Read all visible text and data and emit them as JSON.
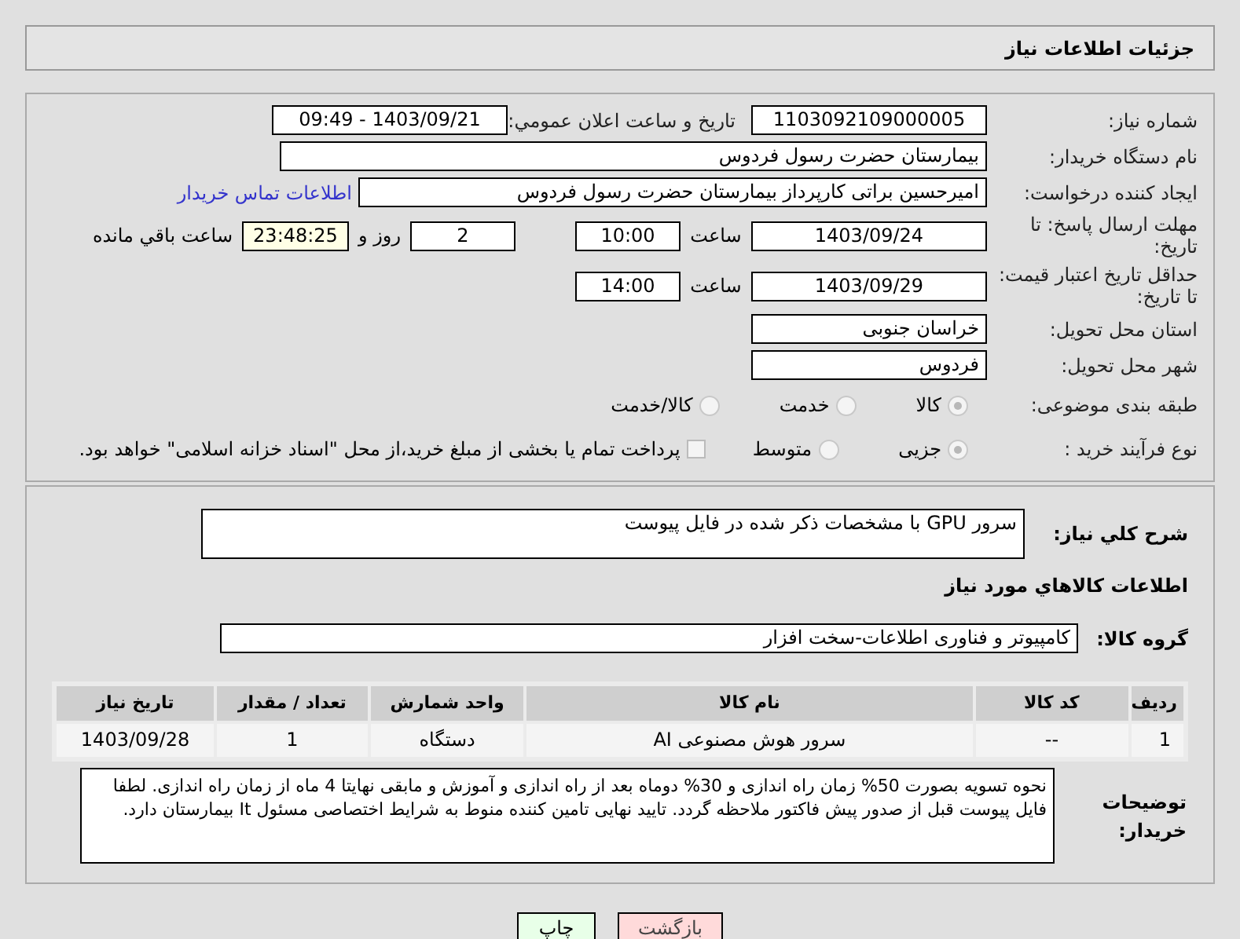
{
  "header": {
    "title": "جزئیات اطلاعات نیاز"
  },
  "details": {
    "need_number": {
      "label": "شماره نیاز:",
      "value": "1103092109000005"
    },
    "announce": {
      "label": "تاریخ و ساعت اعلان عمومي:",
      "value": "1403/09/21 - 09:49"
    },
    "buyer": {
      "label": "نام دستگاه خریدار:",
      "value": "بیمارستان حضرت رسول فردوس"
    },
    "creator": {
      "label": "ایجاد کننده درخواست:",
      "value": "امیرحسین براتی کارپرداز بیمارستان حضرت رسول فردوس",
      "link": "اطلاعات تماس خریدار"
    },
    "deadline": {
      "label": "مهلت ارسال پاسخ: تا تاریخ:",
      "date": "1403/09/24",
      "time_label": "ساعت",
      "time": "10:00",
      "days": "2",
      "days_label": "روز و",
      "remaining": "23:48:25",
      "remaining_label": "ساعت باقي مانده"
    },
    "validity": {
      "label": "حداقل تاریخ اعتبار قیمت: تا تاریخ:",
      "date": "1403/09/29",
      "time_label": "ساعت",
      "time": "14:00"
    },
    "province": {
      "label": "استان محل تحویل:",
      "value": "خراسان جنوبی"
    },
    "city": {
      "label": "شهر محل تحویل:",
      "value": "فردوس"
    },
    "category": {
      "label": "طبقه بندی موضوعی:",
      "options": [
        {
          "label": "کالا",
          "selected": true
        },
        {
          "label": "خدمت",
          "selected": false
        },
        {
          "label": "کالا/خدمت",
          "selected": false
        }
      ]
    },
    "process": {
      "label": "نوع فرآیند خرید :",
      "options": [
        {
          "label": "جزیی",
          "selected": true
        },
        {
          "label": "متوسط",
          "selected": false
        }
      ],
      "treasury": {
        "label": "پرداخت تمام یا بخشی از مبلغ خرید،از محل \"اسناد خزانه اسلامی\" خواهد بود.",
        "checked": false
      }
    }
  },
  "goods": {
    "summary": {
      "label": "شرح کلي نیاز:",
      "value": "سرور GPU  با مشخصات ذکر شده در فایل پیوست"
    },
    "heading": "اطلاعات کالاهاي مورد نیاز",
    "group": {
      "label": "گروه کالا:",
      "value": "کامپیوتر و فناوری اطلاعات-سخت افزار"
    },
    "table": {
      "columns": [
        "ردیف",
        "کد کالا",
        "نام کالا",
        "واحد شمارش",
        "تعداد / مقدار",
        "تاریخ نیاز"
      ],
      "rows": [
        [
          "1",
          "--",
          "سرور هوش مصنوعی AI",
          "دستگاه",
          "1",
          "1403/09/28"
        ]
      ]
    },
    "notes": {
      "label": "توضیحات خریدار:",
      "value": "نحوه تسویه بصورت 50% زمان راه اندازی و 30% دوماه بعد از راه اندازی و آموزش و مابقی نهایتا 4 ماه از زمان راه اندازی. لطفا فایل پیوست قبل از صدور پیش فاکتور ملاحظه گردد. تایید نهایی تامین کننده منوط به شرایط اختصاصی مسئول It  بیمارستان دارد."
    }
  },
  "buttons": [
    {
      "label": "بازگشت",
      "kind": "back"
    },
    {
      "label": "چاپ",
      "kind": "print"
    }
  ]
}
